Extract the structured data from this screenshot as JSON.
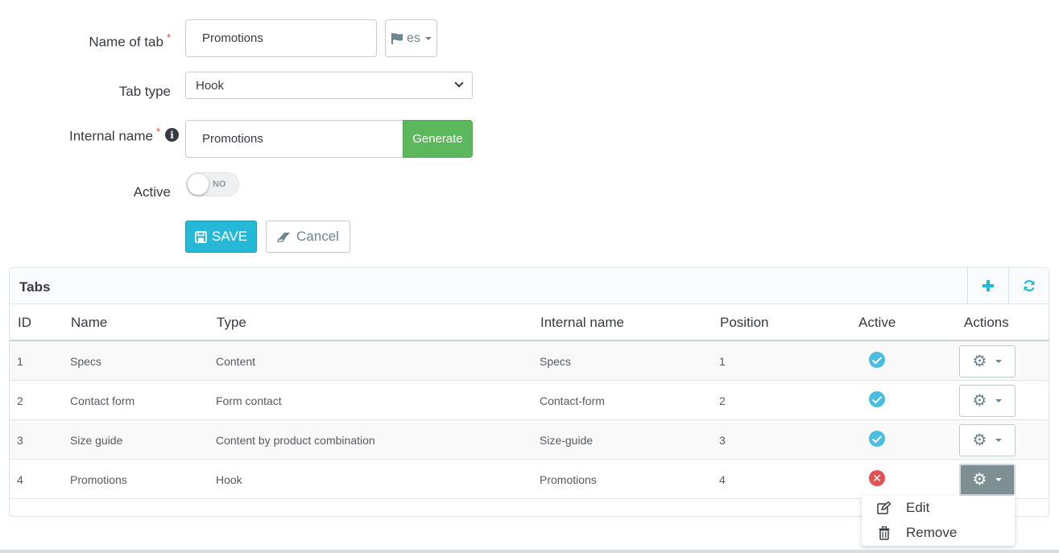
{
  "form": {
    "name_label": "Name of tab",
    "name_value": "Promotions",
    "lang": "es",
    "tab_type_label": "Tab type",
    "tab_type_value": "Hook",
    "internal_label": "Internal name",
    "internal_value": "Promotions",
    "generate_label": "Generate",
    "active_label": "Active",
    "toggle_state": "NO",
    "save_label": "SAVE",
    "cancel_label": "Cancel",
    "required_mark": "*"
  },
  "panel": {
    "title": "Tabs",
    "columns": [
      "ID",
      "Name",
      "Type",
      "Internal name",
      "Position",
      "Active",
      "Actions"
    ],
    "rows": [
      {
        "id": "1",
        "name": "Specs",
        "type": "Content",
        "internal": "Specs",
        "position": "1",
        "active": true
      },
      {
        "id": "2",
        "name": "Contact form",
        "type": "Form contact",
        "internal": "Contact-form",
        "position": "2",
        "active": true
      },
      {
        "id": "3",
        "name": "Size guide",
        "type": "Content by product combination",
        "internal": "Size-guide",
        "position": "3",
        "active": true
      },
      {
        "id": "4",
        "name": "Promotions",
        "type": "Hook",
        "internal": "Promotions",
        "position": "4",
        "active": false
      }
    ]
  },
  "menu": {
    "edit_label": "Edit",
    "remove_label": "Remove"
  },
  "colors": {
    "primary": "#25b9d7",
    "success": "#5cb85c",
    "active_check": "#4bbde0",
    "inactive_cross": "#e15252"
  }
}
